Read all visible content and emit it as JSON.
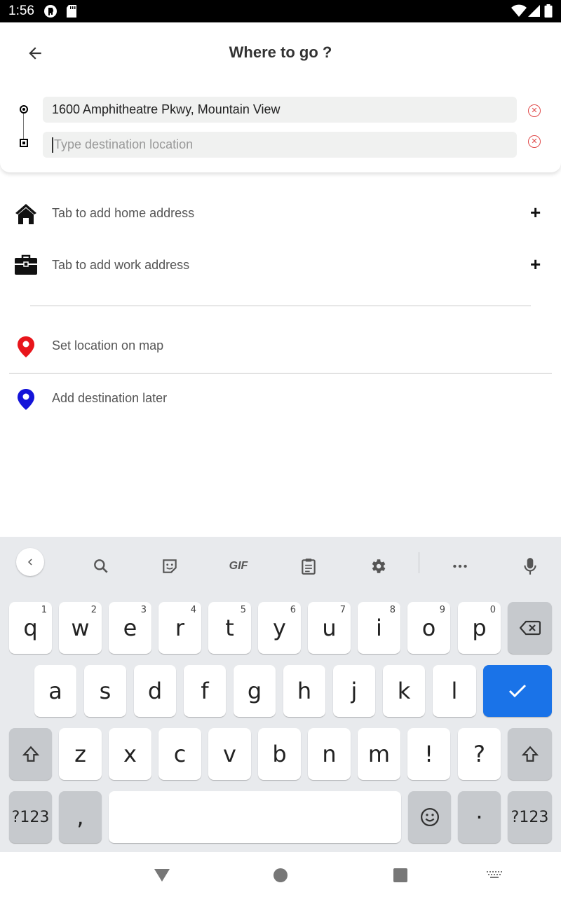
{
  "status_bar": {
    "time": "1:56",
    "icons": [
      "app-notification-icon",
      "sd-card-icon",
      "wifi-icon",
      "cell-signal-icon",
      "battery-icon"
    ]
  },
  "header": {
    "title": "Where to go ?",
    "origin_value": "1600 Amphitheatre Pkwy, Mountain View",
    "destination_placeholder": "Type destination location",
    "clear_glyph": "✕"
  },
  "shortcuts": [
    {
      "label": "Tab to add home address",
      "icon": "home-icon",
      "action": "+"
    },
    {
      "label": "Tab to add work address",
      "icon": "briefcase-icon",
      "action": "+"
    }
  ],
  "options": [
    {
      "label": "Set location on map",
      "icon": "location-pin-icon",
      "color": "#e8151b"
    },
    {
      "label": "Add destination later",
      "icon": "location-pin-icon",
      "color": "#1414d9"
    }
  ],
  "keyboard": {
    "toolbar": [
      "collapse-icon",
      "search-icon",
      "sticker-icon",
      "gif-icon",
      "clipboard-icon",
      "settings-icon",
      "more-icon",
      "mic-icon"
    ],
    "gif_label": "GIF",
    "row1": [
      "q",
      "w",
      "e",
      "r",
      "t",
      "y",
      "u",
      "i",
      "o",
      "p"
    ],
    "row1_hints": [
      "1",
      "2",
      "3",
      "4",
      "5",
      "6",
      "7",
      "8",
      "9",
      "0"
    ],
    "row2": [
      "a",
      "s",
      "d",
      "f",
      "g",
      "h",
      "j",
      "k",
      "l"
    ],
    "row3": [
      "z",
      "x",
      "c",
      "v",
      "b",
      "n",
      "m",
      "!",
      "?"
    ],
    "symbols_label": "?123",
    "comma": ",",
    "period": "·",
    "accent_color": "#1a73e8"
  },
  "nav_bar": {
    "icons": [
      "back-triangle-icon",
      "home-circle-icon",
      "recents-square-icon",
      "keyboard-switch-icon"
    ]
  }
}
